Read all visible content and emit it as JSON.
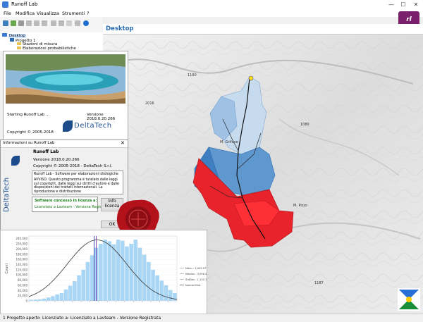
{
  "window": {
    "title": "Runoff Lab",
    "minimize": "—",
    "maximize": "☐",
    "close": "✕"
  },
  "menu": [
    "File",
    "Modifica",
    "Visualizza",
    "Strumenti",
    "?"
  ],
  "tree": {
    "root": "Desktop",
    "project": "Progetto 1",
    "items": [
      "Stazioni di misura",
      "Elaborazioni probabilistiche"
    ]
  },
  "desktop": {
    "title": "Desktop"
  },
  "map": {
    "labels": [
      "M. Grifone",
      "M. Pizzo",
      "1160",
      "1080",
      "1187",
      "2016"
    ]
  },
  "splash": {
    "status": "Starting Runoff Lab ...",
    "version": "Versione 2018.0.20.266",
    "copyright": "Copyright © 2005-2018",
    "brand": "DeltaTech"
  },
  "about": {
    "title": "Informazioni su Runoff Lab",
    "app": "Runoff Lab",
    "version": "Versione 2018.0.20.266",
    "copyright": "Copyright © 2005-2018 - DeltaTech S.r.l.",
    "description": "Runoff Lab - Software per elaborazioni idrologiche",
    "warning": "AVVISO: Questo programma è tutelato dalle leggi sul copyright, dalle leggi sui diritti d'autore e dalle disposizioni dei trattati internazionali. La riproduzione e distribuzione",
    "license_title": "Software concesso in licenza a:",
    "license_text": "Licenziato a Lavteam - Versione Registrata",
    "info_button": "Info licenza",
    "ok_button": "OK",
    "brand": "DeltaTech"
  },
  "chart_data": {
    "type": "bar",
    "ylabel": "Count",
    "yticks": [
      "0",
      "20,000",
      "40,000",
      "60,000",
      "80,000",
      "100,000",
      "120,000",
      "140,000",
      "160,000",
      "180,000",
      "200,000",
      "220,000",
      "240,000"
    ],
    "values": [
      4000,
      4500,
      6000,
      9000,
      13000,
      18000,
      25000,
      30000,
      44000,
      58000,
      76000,
      98000,
      120000,
      150000,
      176000,
      205000,
      220000,
      236000,
      230000,
      218000,
      236000,
      232000,
      210000,
      220000,
      236000,
      205000,
      178000,
      150000,
      120000,
      98000,
      78000,
      60000,
      42000,
      30000
    ],
    "legend": [
      "Mean : 3,043.07111",
      "Median : 3,096.36768",
      "StdDev : 1,130.10150",
      "Normal Dist."
    ],
    "ylim": [
      0,
      250000
    ]
  },
  "status": {
    "items": "1 Progetto aperto",
    "license": "Licenziato a: Licenziato a Lavteam - Versione Registrata"
  }
}
